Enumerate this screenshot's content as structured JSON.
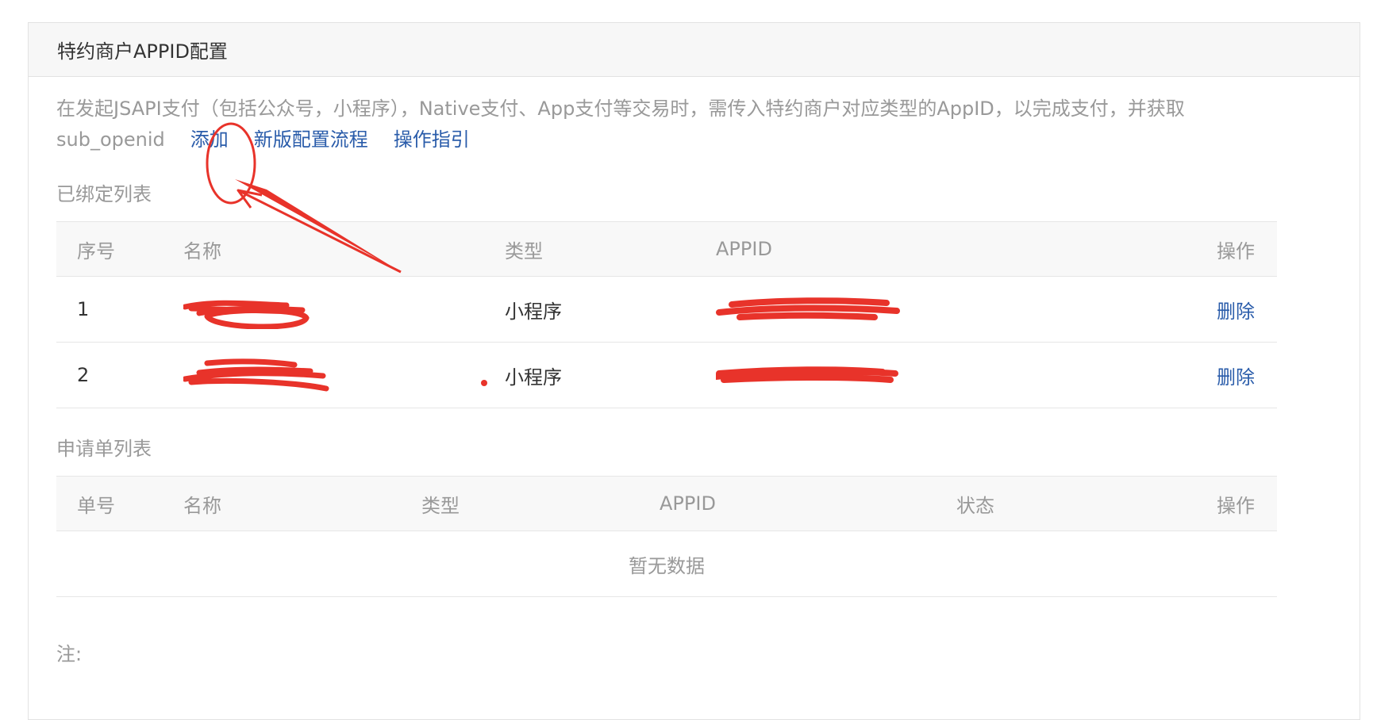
{
  "panel": {
    "title": "特约商户APPID配置"
  },
  "description": {
    "text": "在发起JSAPI支付（包括公众号，小程序），Native支付、App支付等交易时，需传入特约商户对应类型的AppID，以完成支付，并获取sub_openid",
    "links": {
      "add": "添加",
      "new_flow": "新版配置流程",
      "guide": "操作指引"
    }
  },
  "bound_list": {
    "title": "已绑定列表",
    "columns": {
      "index": "序号",
      "name": "名称",
      "type": "类型",
      "appid": "APPID",
      "action": "操作"
    },
    "rows": [
      {
        "index": "1",
        "name": "",
        "type": "小程序",
        "appid": "",
        "action": "删除"
      },
      {
        "index": "2",
        "name": "",
        "type": "小程序",
        "appid": "",
        "action": "删除"
      }
    ]
  },
  "application_list": {
    "title": "申请单列表",
    "columns": {
      "number": "单号",
      "name": "名称",
      "type": "类型",
      "appid": "APPID",
      "status": "状态",
      "action": "操作"
    },
    "empty_text": "暂无数据"
  },
  "note": {
    "label": "注:"
  },
  "colors": {
    "link": "#2a5caa",
    "annotation": "#e8332a",
    "muted_text": "#999999",
    "header_bg": "#f7f7f7"
  }
}
